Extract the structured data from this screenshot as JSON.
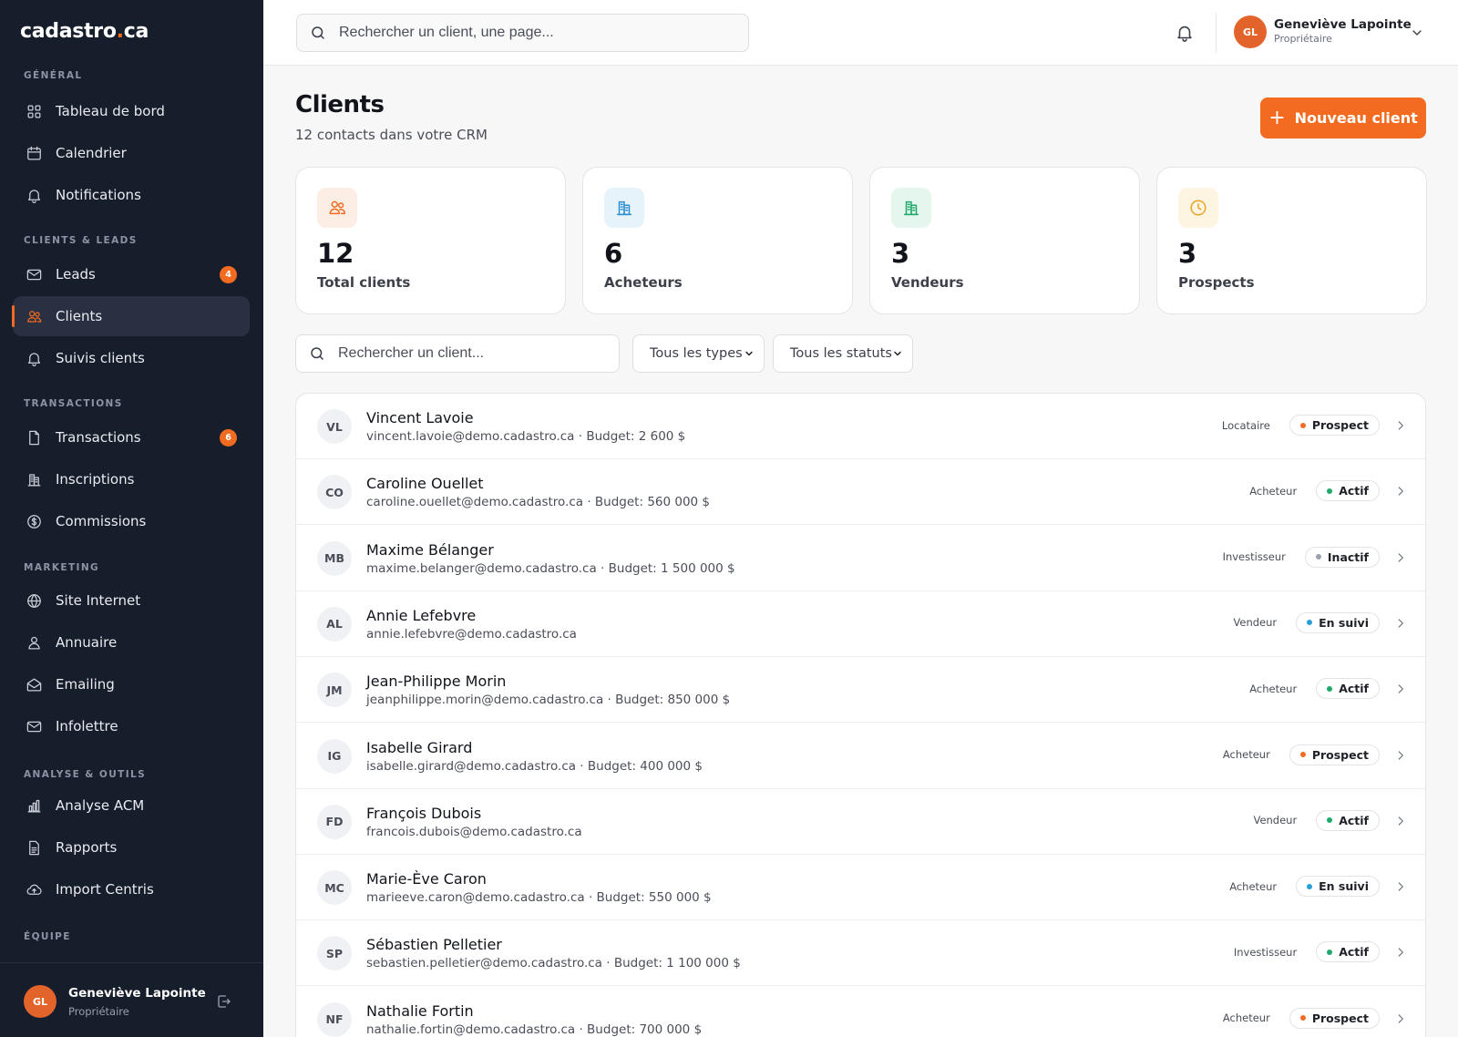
{
  "app": {
    "logo_main": "cadastro",
    "logo_dot": ".",
    "logo_tld": "ca"
  },
  "sidebar": {
    "sections": [
      {
        "label": "GÉNÉRAL"
      },
      {
        "label": "CLIENTS & LEADS"
      },
      {
        "label": "TRANSACTIONS"
      },
      {
        "label": "MARKETING"
      },
      {
        "label": "ANALYSE & OUTILS"
      },
      {
        "label": "ÉQUIPE"
      }
    ],
    "items": [
      {
        "label": "Tableau de bord",
        "icon": "grid-icon"
      },
      {
        "label": "Calendrier",
        "icon": "calendar-icon"
      },
      {
        "label": "Notifications",
        "icon": "bell-icon"
      },
      {
        "label": "Leads",
        "icon": "mail-icon",
        "badge": "4"
      },
      {
        "label": "Clients",
        "icon": "users-icon",
        "active": true
      },
      {
        "label": "Suivis clients",
        "icon": "bell-icon"
      },
      {
        "label": "Transactions",
        "icon": "file-icon",
        "badge": "6"
      },
      {
        "label": "Inscriptions",
        "icon": "building-icon"
      },
      {
        "label": "Commissions",
        "icon": "dollar-icon"
      },
      {
        "label": "Site Internet",
        "icon": "globe-icon"
      },
      {
        "label": "Annuaire",
        "icon": "user-icon"
      },
      {
        "label": "Emailing",
        "icon": "mail-open-icon"
      },
      {
        "label": "Infolettre",
        "icon": "mail-icon"
      },
      {
        "label": "Analyse ACM",
        "icon": "bar-chart-icon"
      },
      {
        "label": "Rapports",
        "icon": "report-icon"
      },
      {
        "label": "Import Centris",
        "icon": "cloud-upload-icon"
      }
    ],
    "user": {
      "initials": "GL",
      "name": "Geneviève Lapointe",
      "role": "Propriétaire"
    }
  },
  "topbar": {
    "search_placeholder": "Rechercher un client, une page...",
    "user": {
      "initials": "GL",
      "name": "Geneviève Lapointe",
      "role": "Propriétaire"
    }
  },
  "page": {
    "title": "Clients",
    "subtitle": "12 contacts dans votre CRM",
    "new_button": "Nouveau client",
    "new_button_plus": "+"
  },
  "stats": [
    {
      "value": "12",
      "label": "Total clients",
      "icon": "users-icon",
      "color": "#f26b21",
      "bg": "#fdeee5"
    },
    {
      "value": "6",
      "label": "Acheteurs",
      "icon": "building-icon",
      "color": "#2f8fd0",
      "bg": "#e6f3fb"
    },
    {
      "value": "3",
      "label": "Vendeurs",
      "icon": "building-icon",
      "color": "#1faa6b",
      "bg": "#e4f6ee"
    },
    {
      "value": "3",
      "label": "Prospects",
      "icon": "clock-icon",
      "color": "#e9a422",
      "bg": "#fdf4e1"
    }
  ],
  "filters": {
    "search_placeholder": "Rechercher un client...",
    "type_select": "Tous les types",
    "status_select": "Tous les statuts"
  },
  "status_colors": {
    "Prospect": "#f26b21",
    "Actif": "#1faa6b",
    "Inactif": "#9aa0ac",
    "En suivi": "#2a9fd6"
  },
  "clients": [
    {
      "initials": "VL",
      "name": "Vincent Lavoie",
      "meta": "vincent.lavoie@demo.cadastro.ca · Budget: 2 600 $",
      "type": "Locataire",
      "status": "Prospect"
    },
    {
      "initials": "CO",
      "name": "Caroline Ouellet",
      "meta": "caroline.ouellet@demo.cadastro.ca · Budget: 560 000 $",
      "type": "Acheteur",
      "status": "Actif"
    },
    {
      "initials": "MB",
      "name": "Maxime Bélanger",
      "meta": "maxime.belanger@demo.cadastro.ca · Budget: 1 500 000 $",
      "type": "Investisseur",
      "status": "Inactif"
    },
    {
      "initials": "AL",
      "name": "Annie Lefebvre",
      "meta": "annie.lefebvre@demo.cadastro.ca",
      "type": "Vendeur",
      "status": "En suivi"
    },
    {
      "initials": "JM",
      "name": "Jean-Philippe Morin",
      "meta": "jeanphilippe.morin@demo.cadastro.ca · Budget: 850 000 $",
      "type": "Acheteur",
      "status": "Actif"
    },
    {
      "initials": "IG",
      "name": "Isabelle Girard",
      "meta": "isabelle.girard@demo.cadastro.ca · Budget: 400 000 $",
      "type": "Acheteur",
      "status": "Prospect"
    },
    {
      "initials": "FD",
      "name": "François Dubois",
      "meta": "francois.dubois@demo.cadastro.ca",
      "type": "Vendeur",
      "status": "Actif"
    },
    {
      "initials": "MC",
      "name": "Marie-Ève Caron",
      "meta": "marieeve.caron@demo.cadastro.ca · Budget: 550 000 $",
      "type": "Acheteur",
      "status": "En suivi"
    },
    {
      "initials": "SP",
      "name": "Sébastien Pelletier",
      "meta": "sebastien.pelletier@demo.cadastro.ca · Budget: 1 100 000 $",
      "type": "Investisseur",
      "status": "Actif"
    },
    {
      "initials": "NF",
      "name": "Nathalie Fortin",
      "meta": "nathalie.fortin@demo.cadastro.ca · Budget: 700 000 $",
      "type": "Acheteur",
      "status": "Prospect"
    }
  ]
}
